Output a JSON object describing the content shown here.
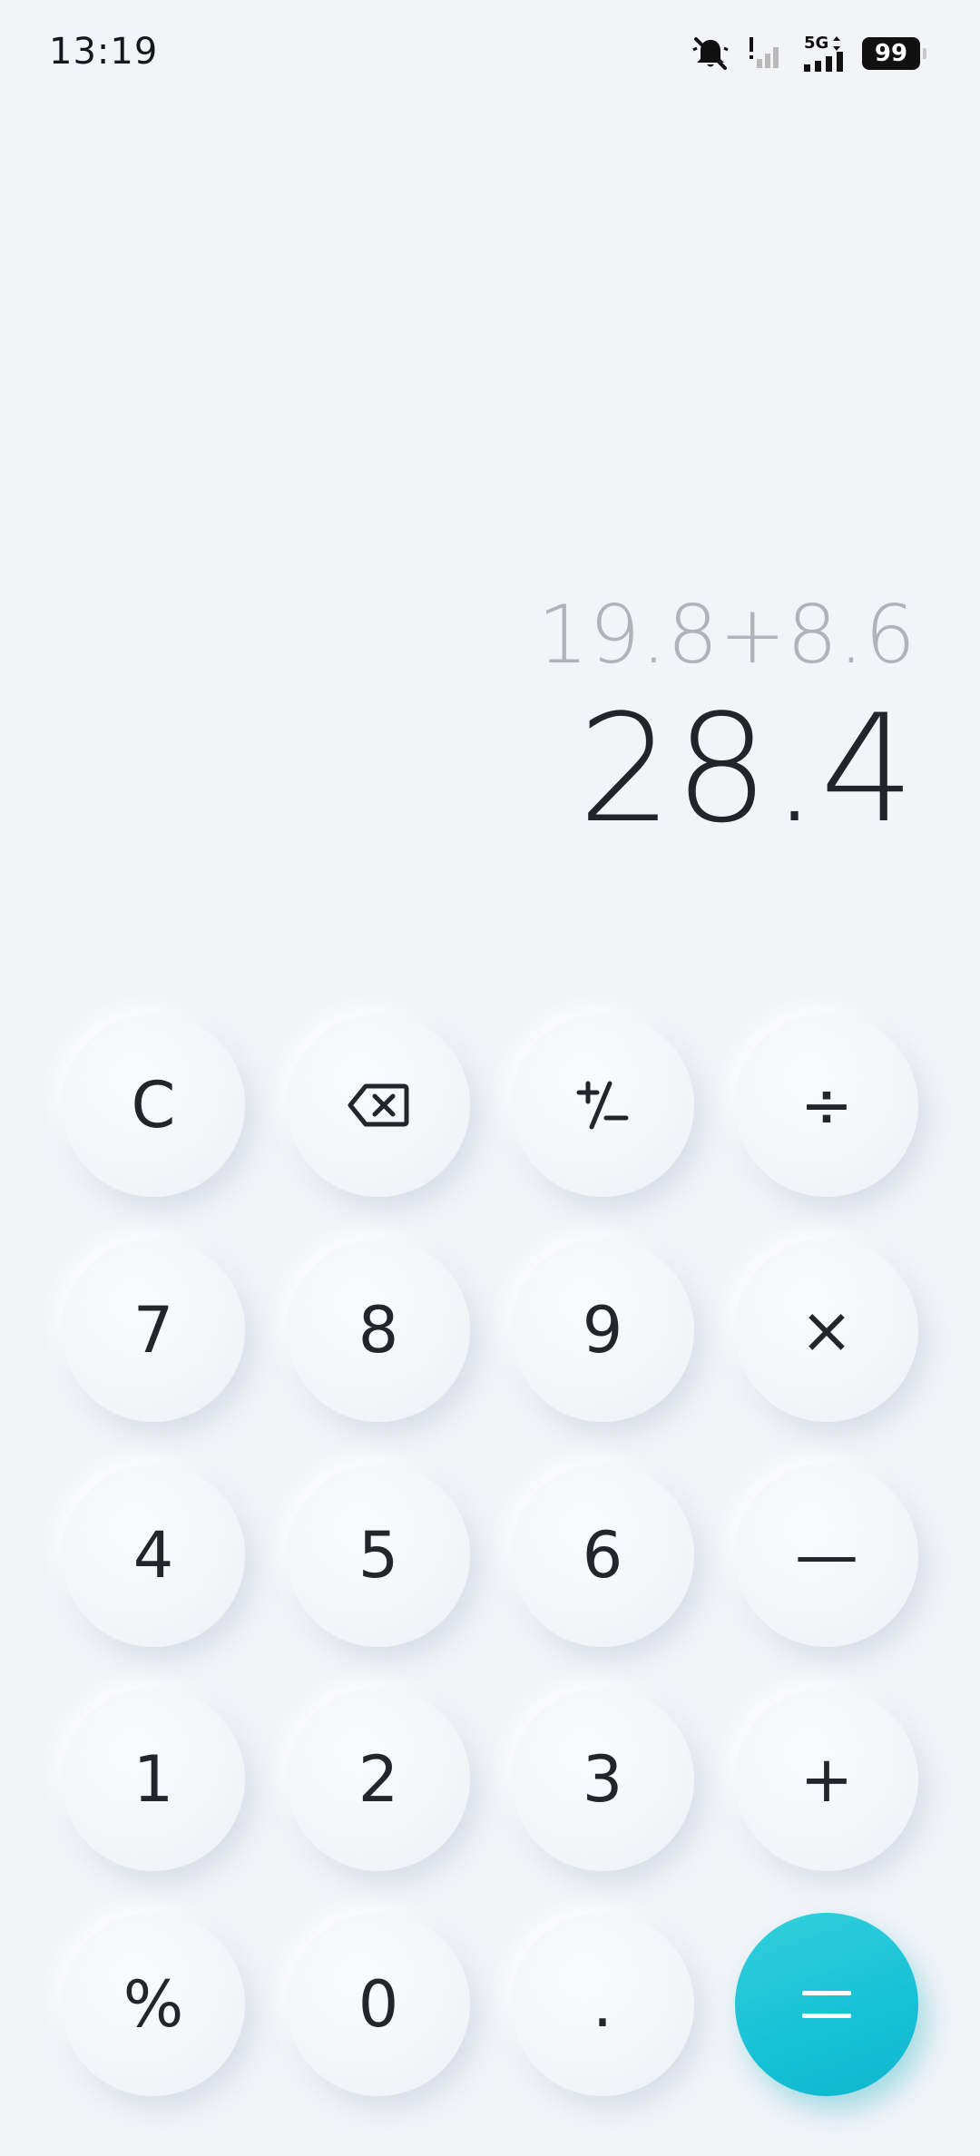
{
  "status_bar": {
    "time": "13:19",
    "network_type": "5G",
    "battery_level": "99",
    "icons": [
      "mute-icon",
      "signal-no-sim-icon",
      "signal-5g-icon",
      "battery-icon"
    ]
  },
  "display": {
    "expression": "19.8+8.6",
    "result": "28.4"
  },
  "keypad": {
    "clear": "C",
    "backspace_icon": "backspace-icon",
    "sign_toggle_icon": "plus-minus-icon",
    "divide": "÷",
    "seven": "7",
    "eight": "8",
    "nine": "9",
    "multiply": "×",
    "four": "4",
    "five": "5",
    "six": "6",
    "minus": "—",
    "one": "1",
    "two": "2",
    "three": "3",
    "plus": "+",
    "percent": "%",
    "zero": "0",
    "decimal": ".",
    "equals_icon": "equals-icon"
  },
  "colors": {
    "background": "#f2f4f8",
    "accent": "#16c1d6",
    "expression_text": "#b0b3b9",
    "result_text": "#22242a"
  }
}
